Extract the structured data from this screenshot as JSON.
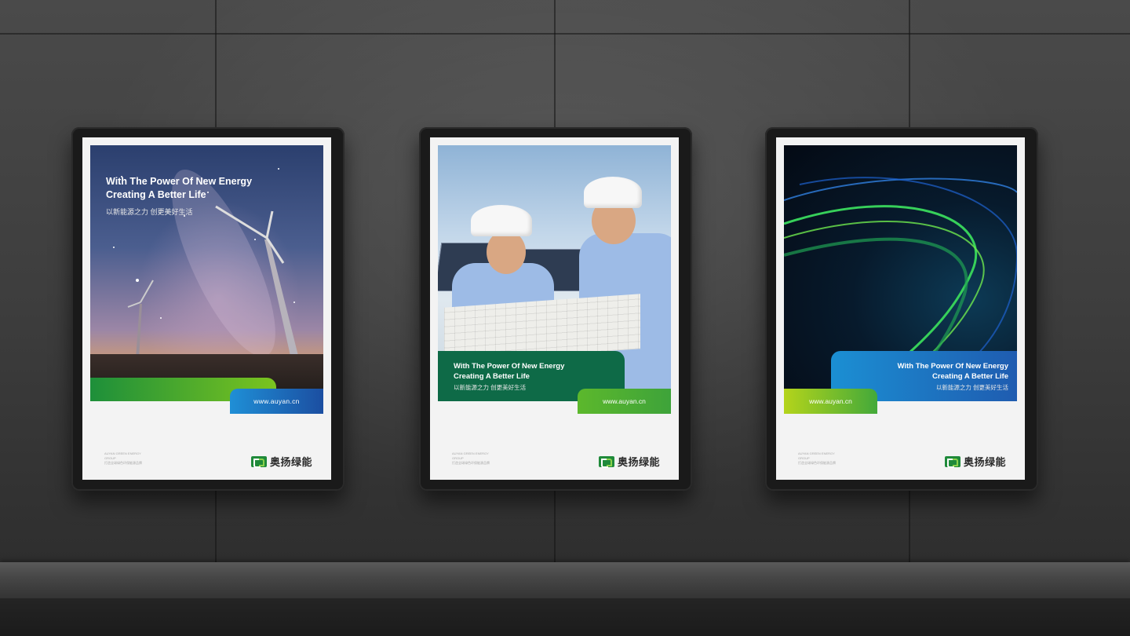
{
  "posters": [
    {
      "title_line1": "With The Power Of New Energy",
      "title_line2": "Creating A Better Life",
      "subtitle": "以新能源之力 创更美好生活",
      "url": "www.auyan.cn",
      "footer_small_1": "AUYAN GREEN ENERGY",
      "footer_small_2": "GROUP",
      "footer_small_3": "打造全球绿色环保能源品牌",
      "brand": "奥扬绿能"
    },
    {
      "title_line1": "With The Power Of New Energy",
      "title_line2": "Creating A Better Life",
      "subtitle": "以新能源之力 创更美好生活",
      "url": "www.auyan.cn",
      "footer_small_1": "AUYAN GREEN ENERGY",
      "footer_small_2": "GROUP",
      "footer_small_3": "打造全球绿色环保能源品牌",
      "brand": "奥扬绿能"
    },
    {
      "title_line1": "With The Power Of New Energy",
      "title_line2": "Creating A Better Life",
      "subtitle": "以新能源之力 创更美好生活",
      "url": "www.auyan.cn",
      "footer_small_1": "AUYAN GREEN ENERGY",
      "footer_small_2": "GROUP",
      "footer_small_3": "打造全球绿色环保能源品牌",
      "brand": "奥扬绿能"
    }
  ],
  "colors": {
    "brand_green": "#1f8a3a",
    "dark_green": "#0e6a47",
    "lime": "#7bc41f",
    "blue": "#1f5cb0"
  },
  "icons": [
    "brand-logo-icon",
    "wind-turbine-icon",
    "solar-panel-icon"
  ]
}
